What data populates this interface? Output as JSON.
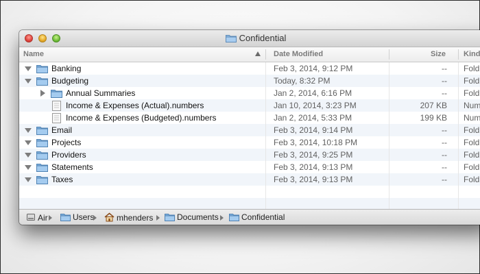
{
  "window": {
    "title": "Confidential"
  },
  "columns": {
    "name": "Name",
    "date": "Date Modified",
    "size": "Size",
    "kind": "Kind"
  },
  "rows": [
    {
      "name": "Banking",
      "date": "Feb 3, 2014, 9:12 PM",
      "size": "--",
      "kind": "Fold",
      "type": "folder",
      "disclosure": "open",
      "indent": 0
    },
    {
      "name": "Budgeting",
      "date": "Today, 8:32 PM",
      "size": "--",
      "kind": "Fold",
      "type": "folder",
      "disclosure": "open",
      "indent": 0
    },
    {
      "name": "Annual Summaries",
      "date": "Jan 2, 2014, 6:16 PM",
      "size": "--",
      "kind": "Fold",
      "type": "folder",
      "disclosure": "closed",
      "indent": 1
    },
    {
      "name": "Income & Expenses (Actual).numbers",
      "date": "Jan 10, 2014, 3:23 PM",
      "size": "207 KB",
      "kind": "Num",
      "type": "file",
      "disclosure": "none",
      "indent": 1
    },
    {
      "name": "Income & Expenses (Budgeted).numbers",
      "date": "Jan 2, 2014, 5:33 PM",
      "size": "199 KB",
      "kind": "Num",
      "type": "file",
      "disclosure": "none",
      "indent": 1
    },
    {
      "name": "Email",
      "date": "Feb 3, 2014, 9:14 PM",
      "size": "--",
      "kind": "Fold",
      "type": "folder",
      "disclosure": "open",
      "indent": 0
    },
    {
      "name": "Projects",
      "date": "Feb 3, 2014, 10:18 PM",
      "size": "--",
      "kind": "Fold",
      "type": "folder",
      "disclosure": "open",
      "indent": 0
    },
    {
      "name": "Providers",
      "date": "Feb 3, 2014, 9:25 PM",
      "size": "--",
      "kind": "Fold",
      "type": "folder",
      "disclosure": "open",
      "indent": 0
    },
    {
      "name": "Statements",
      "date": "Feb 3, 2014, 9:13 PM",
      "size": "--",
      "kind": "Fold",
      "type": "folder",
      "disclosure": "open",
      "indent": 0
    },
    {
      "name": "Taxes",
      "date": "Feb 3, 2014, 9:13 PM",
      "size": "--",
      "kind": "Fold",
      "type": "folder",
      "disclosure": "open",
      "indent": 0
    }
  ],
  "path_bar": [
    {
      "label": "Air",
      "icon": "hard-drive-icon"
    },
    {
      "label": "Users",
      "icon": "folder-icon"
    },
    {
      "label": "mhenders",
      "icon": "home-icon"
    },
    {
      "label": "Documents",
      "icon": "documents-folder-icon"
    },
    {
      "label": "Confidential",
      "icon": "folder-icon"
    }
  ]
}
